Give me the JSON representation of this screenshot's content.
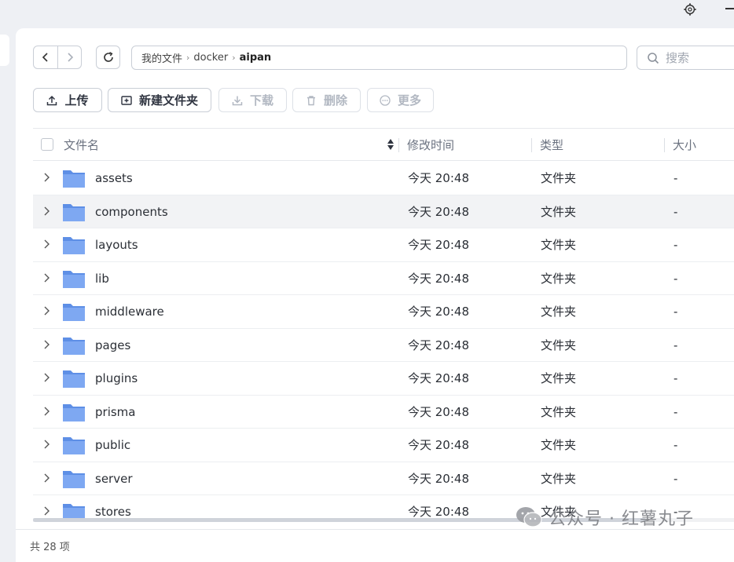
{
  "toolbar_nav": {
    "breadcrumb": [
      "我的文件",
      "docker",
      "aipan"
    ],
    "search_placeholder": "搜索"
  },
  "actions": {
    "upload": "上传",
    "new_folder": "新建文件夹",
    "download": "下载",
    "delete": "删除",
    "more": "更多"
  },
  "columns": {
    "name": "文件名",
    "modified": "修改时间",
    "type": "类型",
    "size": "大小"
  },
  "rows": [
    {
      "name": "assets",
      "modified": "今天 20:48",
      "type": "文件夹",
      "size": "-"
    },
    {
      "name": "components",
      "modified": "今天 20:48",
      "type": "文件夹",
      "size": "-"
    },
    {
      "name": "layouts",
      "modified": "今天 20:48",
      "type": "文件夹",
      "size": "-"
    },
    {
      "name": "lib",
      "modified": "今天 20:48",
      "type": "文件夹",
      "size": "-"
    },
    {
      "name": "middleware",
      "modified": "今天 20:48",
      "type": "文件夹",
      "size": "-"
    },
    {
      "name": "pages",
      "modified": "今天 20:48",
      "type": "文件夹",
      "size": "-"
    },
    {
      "name": "plugins",
      "modified": "今天 20:48",
      "type": "文件夹",
      "size": "-"
    },
    {
      "name": "prisma",
      "modified": "今天 20:48",
      "type": "文件夹",
      "size": "-"
    },
    {
      "name": "public",
      "modified": "今天 20:48",
      "type": "文件夹",
      "size": "-"
    },
    {
      "name": "server",
      "modified": "今天 20:48",
      "type": "文件夹",
      "size": "-"
    },
    {
      "name": "stores",
      "modified": "今天 20:48",
      "type": "文件夹",
      "size": "-"
    }
  ],
  "footer": {
    "count": "共 28 项"
  },
  "watermark": "公众号 · 红薯丸子",
  "colors": {
    "folder": "#7ea8f2",
    "folder_tab": "#5e8fe6",
    "hover_row": "#f2f3f5"
  }
}
